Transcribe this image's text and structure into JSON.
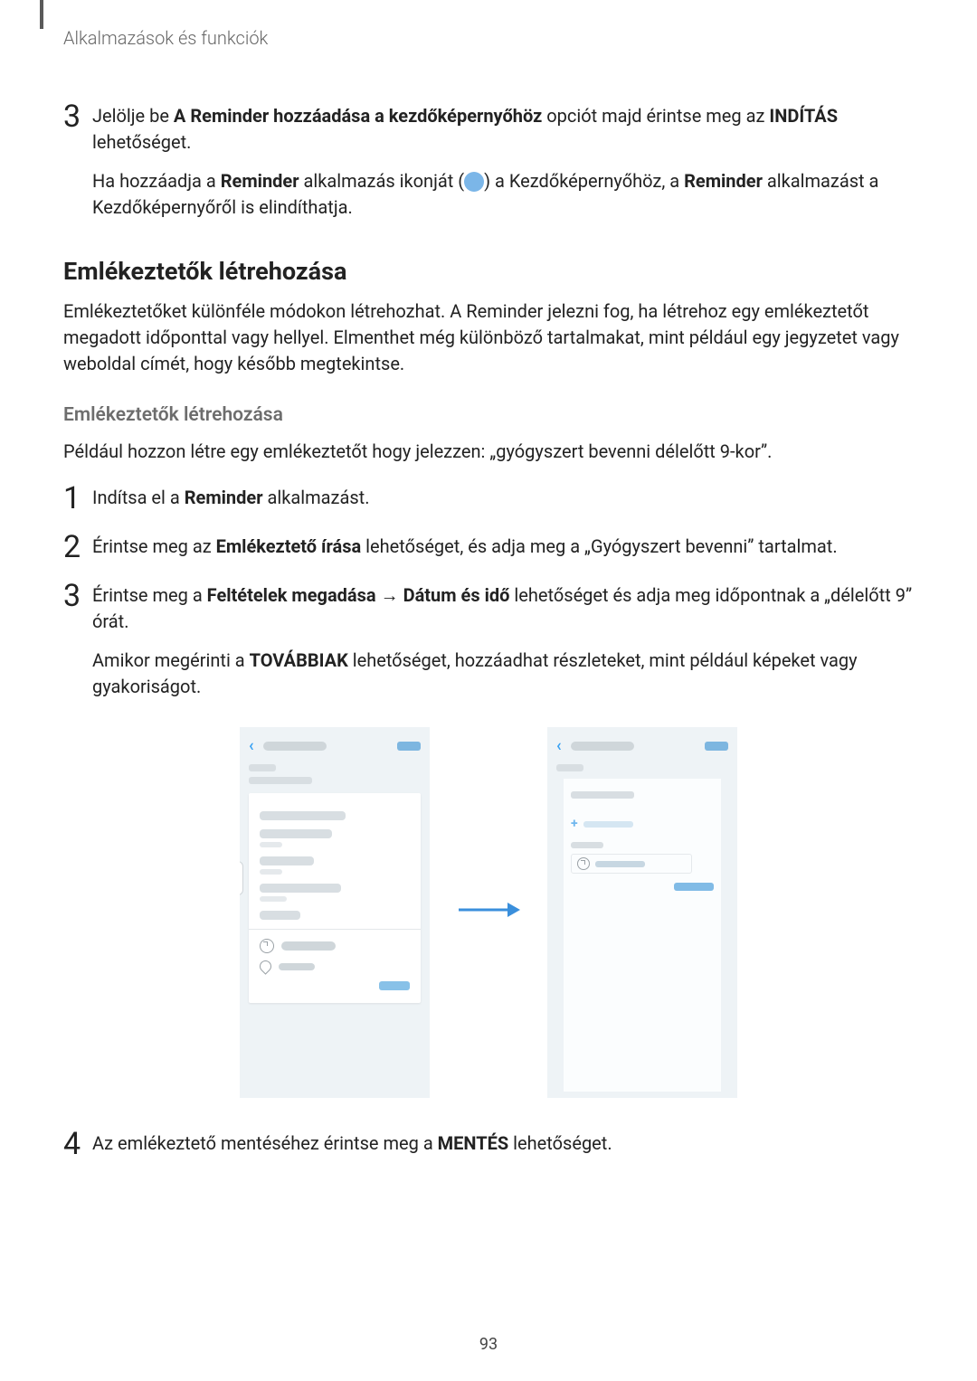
{
  "header": "Alkalmazások és funkciók",
  "page_number": "93",
  "step3": {
    "num": "3",
    "pre": "Jelölje be ",
    "bold1": "A Reminder hozzáadása a kezdőképernyőhöz",
    "mid": " opciót majd érintse meg az ",
    "bold2": "INDÍTÁS",
    "post": " lehetőséget.",
    "extra_pre": "Ha hozzáadja a ",
    "extra_b1": "Reminder",
    "extra_mid": " alkalmazás ikonját (",
    "extra_mid2": ") a Kezdőképernyőhöz, a ",
    "extra_b2": "Reminder",
    "extra_post": " alkalmazást a Kezdőképernyőről is elindíthatja."
  },
  "h2": "Emlékeztetők létrehozása",
  "para1": "Emlékeztetőket különféle módokon létrehozhat. A Reminder jelezni fog, ha létrehoz egy emlékeztetőt megadott időponttal vagy hellyel. Elmenthet még különböző tartalmakat, mint például egy jegyzetet vagy weboldal címét, hogy később megtekintse.",
  "h3": "Emlékeztetők létrehozása",
  "para2": "Például hozzon létre egy emlékeztetőt hogy jelezzen: „gyógyszert bevenni délelőtt 9-kor”.",
  "s1": {
    "num": "1",
    "pre": "Indítsa el a ",
    "bold": "Reminder",
    "post": " alkalmazást."
  },
  "s2": {
    "num": "2",
    "pre": "Érintse meg az ",
    "bold": "Emlékeztető írása",
    "post": " lehetőséget, és adja meg a „Gyógyszert bevenni” tartalmat."
  },
  "s3": {
    "num": "3",
    "pre": "Érintse meg a ",
    "bold1": "Feltételek megadása",
    "arrow": " → ",
    "bold2": "Dátum és idő",
    "post": " lehetőséget és adja meg időpontnak a „délelőtt 9” órát.",
    "extra_pre": "Amikor megérinti a ",
    "extra_bold": "TOVÁBBIAK",
    "extra_post": " lehetőséget, hozzáadhat részleteket, mint például képeket vagy gyakoriságot."
  },
  "s4": {
    "num": "4",
    "pre": "Az emlékeztető mentéséhez érintse meg a ",
    "bold": "MENTÉS",
    "post": " lehetőséget."
  }
}
